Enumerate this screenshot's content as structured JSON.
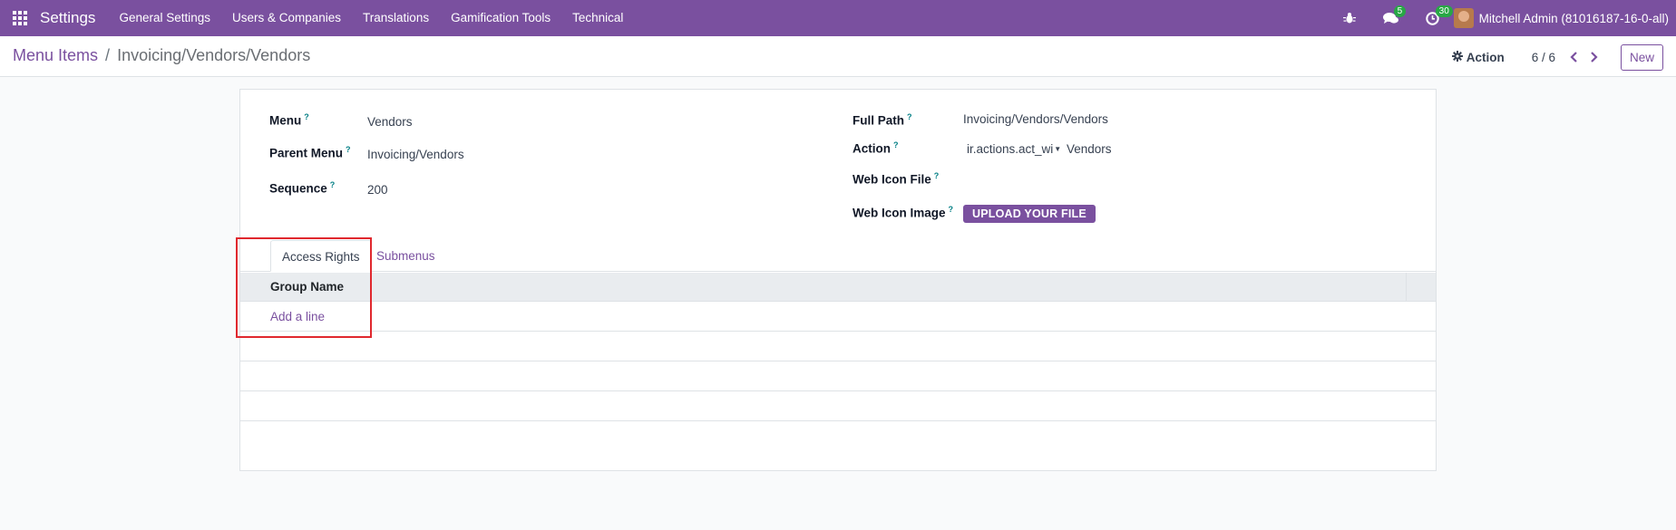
{
  "navbar": {
    "brand": "Settings",
    "menu": [
      "General Settings",
      "Users & Companies",
      "Translations",
      "Gamification Tools",
      "Technical"
    ],
    "messages_count": "5",
    "activities_count": "30",
    "user": "Mitchell Admin (81016187-16-0-all)",
    "accent_color": "#7a509f"
  },
  "control_panel": {
    "breadcrumb_parent": "Menu Items",
    "breadcrumb_separator": "/",
    "breadcrumb_current": "Invoicing/Vendors/Vendors",
    "action_label": "Action",
    "pager": "6 / 6",
    "new_label": "New"
  },
  "form": {
    "menu_label": "Menu",
    "menu_value": "Vendors",
    "parent_menu_label": "Parent Menu",
    "parent_menu_value": "Invoicing/Vendors",
    "sequence_label": "Sequence",
    "sequence_value": "200",
    "full_path_label": "Full Path",
    "full_path_value": "Invoicing/Vendors/Vendors",
    "action_label": "Action",
    "action_type_value": "ir.actions.act_wi",
    "action_value": "Vendors",
    "web_icon_file_label": "Web Icon File",
    "web_icon_image_label": "Web Icon Image",
    "upload_label": "UPLOAD YOUR FILE",
    "help_mark": "?"
  },
  "tabs": {
    "access_rights": "Access Rights",
    "submenus": "Submenus"
  },
  "list": {
    "column_group_name": "Group Name",
    "add_line": "Add a line"
  },
  "highlight_color": "#e0282e"
}
